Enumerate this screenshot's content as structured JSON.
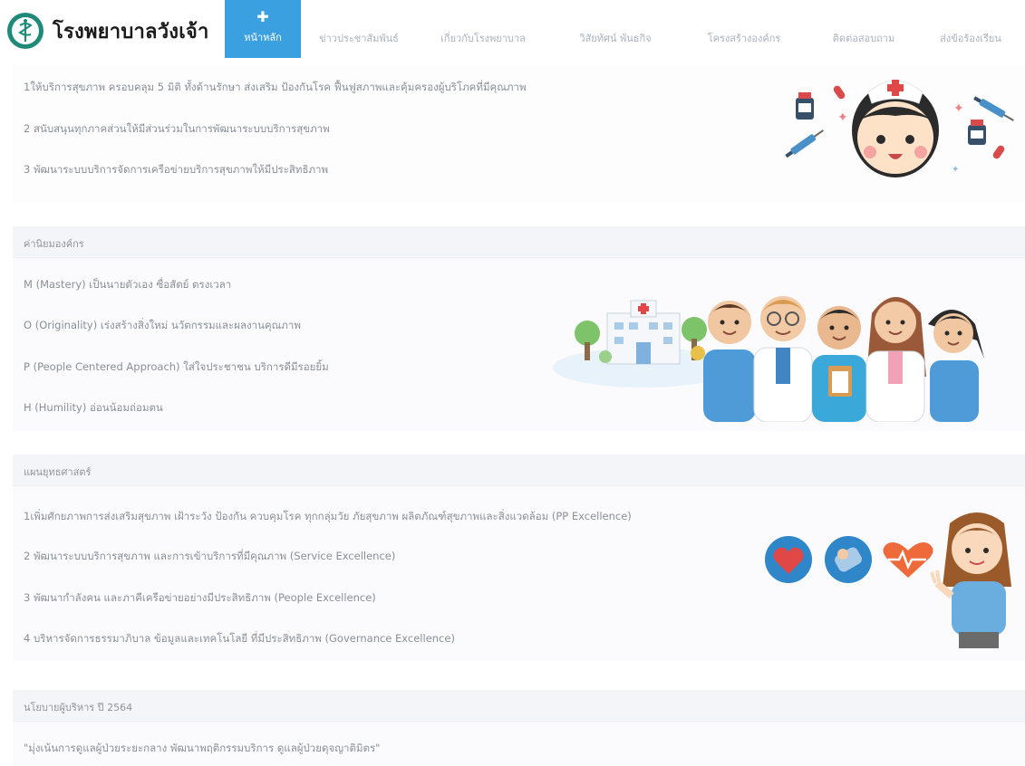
{
  "brand": {
    "name": "โรงพยาบาลวังเจ้า"
  },
  "nav": {
    "home_label": "หน้าหลัก",
    "items": [
      "ข่าวประชาสัมพันธ์",
      "เกี่ยวกับโรงพยาบาล",
      "วิสัยทัศน์ พันธกิจ",
      "โครงสร้างองค์กร",
      "ติดต่อสอบถาม",
      "ส่งข้อร้องเรียน"
    ]
  },
  "mission": {
    "items": [
      "1ให้บริการสุขภาพ ครอบคลุม 5 มิติ ทั้งด้านรักษา ส่งเสริม ป้องกันโรค ฟื้นฟูสภาพและคุ้มครองผู้บริโภคที่มีคุณภาพ",
      "2 สนับสนุนทุกภาคส่วนให้มีส่วนร่วมในการพัฒนาระบบบริการสุขภาพ",
      "3 พัฒนาระบบบริการจัดการเครือข่ายบริการสุขภาพให้มีประสิทธิภาพ"
    ]
  },
  "values": {
    "title": "ค่านิยมองค์กร",
    "items": [
      "M (Mastery) เป็นนายตัวเอง ซื่อสัตย์ ตรงเวลา",
      "O (Originality) เร่งสร้างสิ่งใหม่ นวัตกรรมและผลงานคุณภาพ",
      "P (People Centered Approach) ใส่ใจประชาชน บริการดีมีรอยยิ้ม",
      "H (Humility) อ่อนน้อมถ่อมตน"
    ]
  },
  "strategy": {
    "title": "แผนยุทธศาสตร์",
    "items": [
      "1เพิ่มศักยภาพการส่งเสริมสุขภาพ เฝ้าระวัง ป้องกัน ควบคุมโรค ทุกกลุ่มวัย ภัยสุขภาพ ผลิตภัณฑ์สุขภาพและสิ่งแวดล้อม (PP Excellence)",
      "2 พัฒนาระบบบริการสุขภาพ และการเข้าบริการที่มีคุณภาพ (Service Excellence)",
      "3 พัฒนากำลังคน และภาคีเครือข่ายอย่างมีประสิทธิภาพ (People Excellence)",
      "4 บริหารจัดการธรรมาภิบาล ข้อมูลและเทคโนโลยี ที่มีประสิทธิภาพ (Governance Excellence)"
    ]
  },
  "policy": {
    "title": "นโยบายผู้บริหาร ปี 2564",
    "text": "\"มุ่งเน้นการดูแลผู้ป่วยระยะกลาง พัฒนาพฤติกรรมบริการ ดูแลผู้ป่วยดุจญาติมิตร\""
  },
  "colors": {
    "nav_active": "#3aa0e0",
    "logo_green": "#1f8a7a"
  }
}
